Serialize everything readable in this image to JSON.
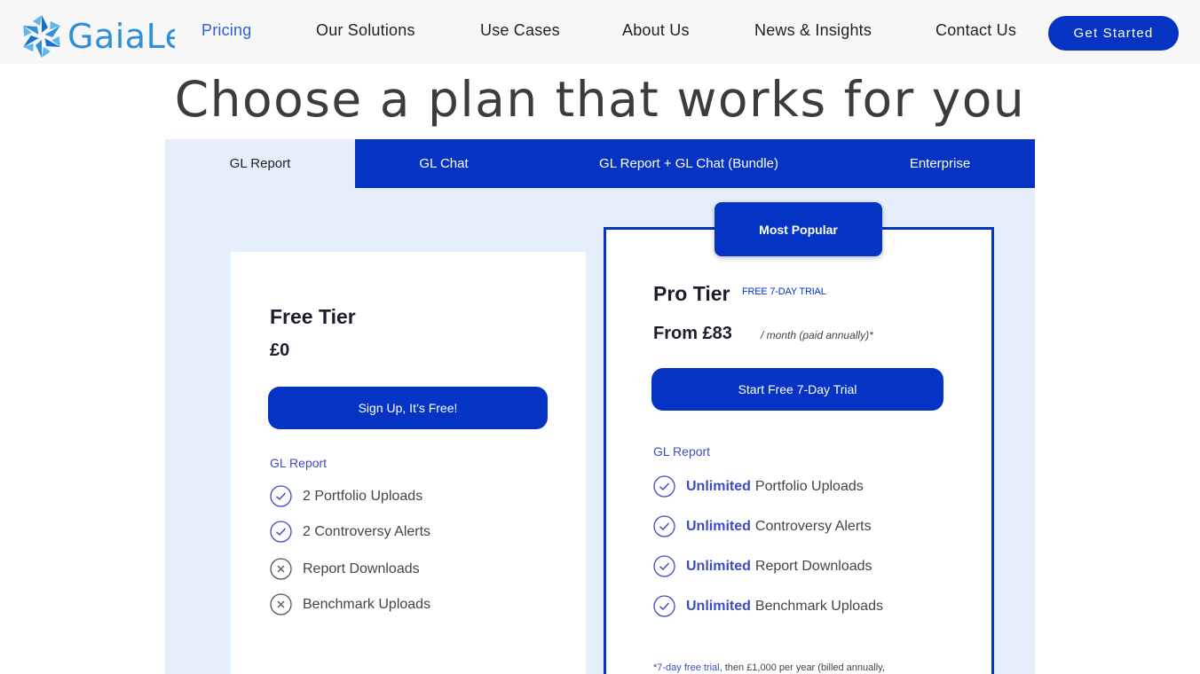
{
  "brand": {
    "name": "GaiaLens",
    "logo_color": "#2f8fd8"
  },
  "nav": {
    "items": [
      {
        "label": "Pricing",
        "active": true
      },
      {
        "label": "Our Solutions",
        "active": false
      },
      {
        "label": "Use Cases",
        "active": false
      },
      {
        "label": "About Us",
        "active": false
      },
      {
        "label": "News & Insights",
        "active": false
      },
      {
        "label": "Contact Us",
        "active": false
      }
    ],
    "cta_label": "Get Started"
  },
  "page": {
    "title": "Choose a plan that works for you"
  },
  "tabs": [
    {
      "label": "GL Report",
      "active": true
    },
    {
      "label": "GL Chat",
      "active": false
    },
    {
      "label": "GL Report + GL Chat (Bundle)",
      "active": false
    },
    {
      "label": "Enterprise",
      "active": false
    }
  ],
  "plans": {
    "free": {
      "name": "Free Tier",
      "price": "£0",
      "button": "Sign Up, It’s Free!",
      "section": "GL Report",
      "features": [
        {
          "text": "2 Portfolio Uploads",
          "included": true,
          "icon": "check-circle-icon"
        },
        {
          "text": "2 Controversy Alerts",
          "included": true,
          "icon": "check-circle-icon"
        },
        {
          "text": "Report Downloads",
          "included": false,
          "icon": "x-circle-icon"
        },
        {
          "text": "Benchmark Uploads",
          "included": false,
          "icon": "x-circle-icon"
        }
      ]
    },
    "pro": {
      "badge": "Most Popular",
      "name": "Pro Tier",
      "trial_label": "FREE 7-DAY TRIAL",
      "price": "From £83",
      "period": "/ month (paid annually)*",
      "button": "Start Free 7-Day Trial",
      "section": "GL Report",
      "features": [
        {
          "highlight": "Unlimited",
          "text": "Portfolio Uploads",
          "icon": "check-circle-icon"
        },
        {
          "highlight": "Unlimited",
          "text": "Controversy Alerts",
          "icon": "check-circle-icon"
        },
        {
          "highlight": "Unlimited",
          "text": "Report Downloads",
          "icon": "check-circle-icon"
        },
        {
          "highlight": "Unlimited",
          "text": "Benchmark Uploads",
          "icon": "check-circle-icon"
        }
      ],
      "footnote_star": "*",
      "footnote_link": "7-day free trial",
      "footnote_rest": ", then £1,000 per year (billed annually,"
    }
  },
  "colors": {
    "primary": "#0533c4",
    "accent_text": "#3b4cc0",
    "panel_bg": "#e6eefb",
    "active_nav": "#2b63d6"
  }
}
